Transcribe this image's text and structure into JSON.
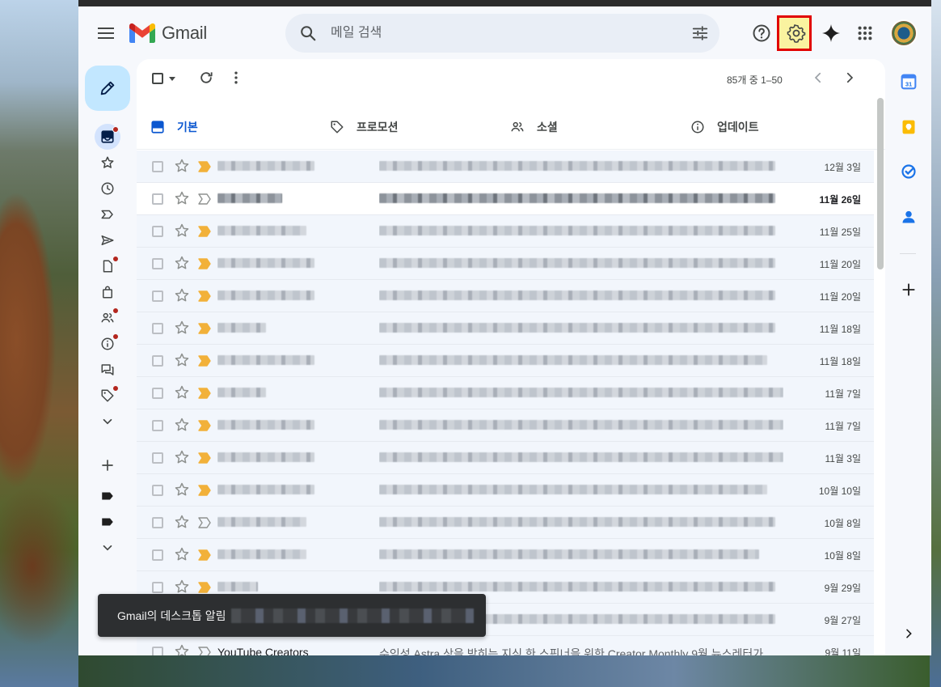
{
  "app": {
    "name": "Gmail"
  },
  "search": {
    "placeholder": "메일 검색"
  },
  "toolbar": {
    "pager": "85개 중 1–50"
  },
  "tabs": [
    {
      "label": "기본",
      "icon": "inbox-icon",
      "active": true
    },
    {
      "label": "프로모션",
      "icon": "tag-icon",
      "active": false
    },
    {
      "label": "소셜",
      "icon": "people-icon",
      "active": false
    },
    {
      "label": "업데이트",
      "icon": "info-icon",
      "active": false
    }
  ],
  "left_nav": [
    {
      "icon": "inbox-icon",
      "badge": true,
      "active": true
    },
    {
      "icon": "star-icon",
      "badge": false
    },
    {
      "icon": "clock-icon",
      "badge": false
    },
    {
      "icon": "important-icon",
      "badge": false
    },
    {
      "icon": "send-icon",
      "badge": false
    },
    {
      "icon": "draft-icon",
      "badge": true
    },
    {
      "icon": "shopping-bag-icon",
      "badge": false
    },
    {
      "icon": "people-icon",
      "badge": true
    },
    {
      "icon": "info-icon",
      "badge": true
    },
    {
      "icon": "forum-icon",
      "badge": false
    },
    {
      "icon": "tag-icon",
      "badge": true
    },
    {
      "icon": "chevron-down-icon",
      "badge": false
    },
    {
      "icon": "plus-icon",
      "badge": false
    },
    {
      "icon": "label-icon",
      "badge": false
    },
    {
      "icon": "label-icon",
      "badge": false
    },
    {
      "icon": "chevron-down-icon",
      "badge": false
    }
  ],
  "emails": [
    {
      "date": "12월 3일",
      "unread": false,
      "important": true
    },
    {
      "date": "11월 26일",
      "unread": true,
      "important": false
    },
    {
      "date": "11월 25일",
      "unread": false,
      "important": true
    },
    {
      "date": "11월 20일",
      "unread": false,
      "important": true
    },
    {
      "date": "11월 20일",
      "unread": false,
      "important": true
    },
    {
      "date": "11월 18일",
      "unread": false,
      "important": true
    },
    {
      "date": "11월 18일",
      "unread": false,
      "important": true
    },
    {
      "date": "11월 7일",
      "unread": false,
      "important": true
    },
    {
      "date": "11월 7일",
      "unread": false,
      "important": true
    },
    {
      "date": "11월 3일",
      "unread": false,
      "important": true
    },
    {
      "date": "10월 10일",
      "unread": false,
      "important": true
    },
    {
      "date": "10월 8일",
      "unread": false,
      "important": false
    },
    {
      "date": "10월 8일",
      "unread": false,
      "important": true
    },
    {
      "date": "9월 29일",
      "unread": false,
      "important": true
    },
    {
      "date": "9월 27일",
      "unread": false,
      "important": true
    },
    {
      "date": "9월 11일",
      "unread": false,
      "important": false,
      "sender": "YouTube Creators",
      "subject": "수익성 Astra 상을 받히는 지식 한 스핀너을 위한 Creator Monthly 9월 뉴스레터가"
    }
  ],
  "toast": {
    "text": "Gmail의 데스크톱 알림"
  },
  "colors": {
    "accent": "#0b57d0",
    "compose_bg": "#c2e7ff",
    "highlight": "#e10000",
    "important": "#f2b13a"
  }
}
